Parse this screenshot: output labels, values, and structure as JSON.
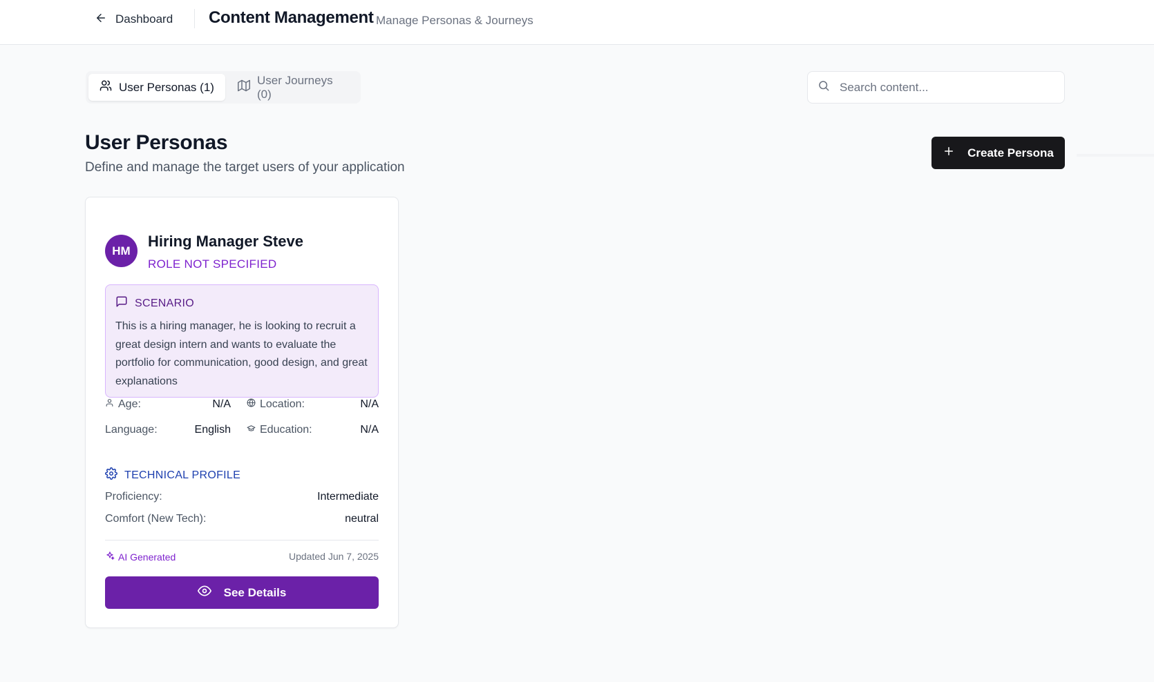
{
  "header": {
    "back_label": "Dashboard",
    "title": "Content Management",
    "subtitle": "Manage Personas & Journeys"
  },
  "tabs": [
    {
      "label": "User Personas (1)",
      "icon": "users-icon",
      "active": true
    },
    {
      "label": "User Journeys (0)",
      "icon": "map-icon",
      "active": false
    }
  ],
  "search": {
    "placeholder": "Search content...",
    "value": ""
  },
  "section": {
    "title": "User Personas",
    "description": "Define and manage the target users of your application",
    "create_label": "Create Persona"
  },
  "persona": {
    "initials": "HM",
    "name": "Hiring Manager Steve",
    "role": "ROLE NOT SPECIFIED",
    "scenario_heading": "SCENARIO",
    "scenario_text": "This is a hiring manager, he is looking to recruit a great design intern and wants to evaluate the portfolio for communication, good design, and great explanations",
    "details": {
      "age_label": "Age:",
      "age_value": "N/A",
      "location_label": "Location:",
      "location_value": "N/A",
      "language_label": "Language:",
      "language_value": "English",
      "education_label": "Education:",
      "education_value": "N/A"
    },
    "technical": {
      "heading": "TECHNICAL PROFILE",
      "proficiency_label": "Proficiency:",
      "proficiency_value": "Intermediate",
      "comfort_label": "Comfort (New Tech):",
      "comfort_value": "neutral"
    },
    "ai_badge": "AI Generated",
    "updated": "Updated Jun 7, 2025",
    "details_button": "See Details"
  },
  "colors": {
    "brand_purple": "#6b21a8",
    "scenario_bg": "#f3ebfa",
    "technical_blue": "#1e40af",
    "primary_dark": "#18181b"
  }
}
